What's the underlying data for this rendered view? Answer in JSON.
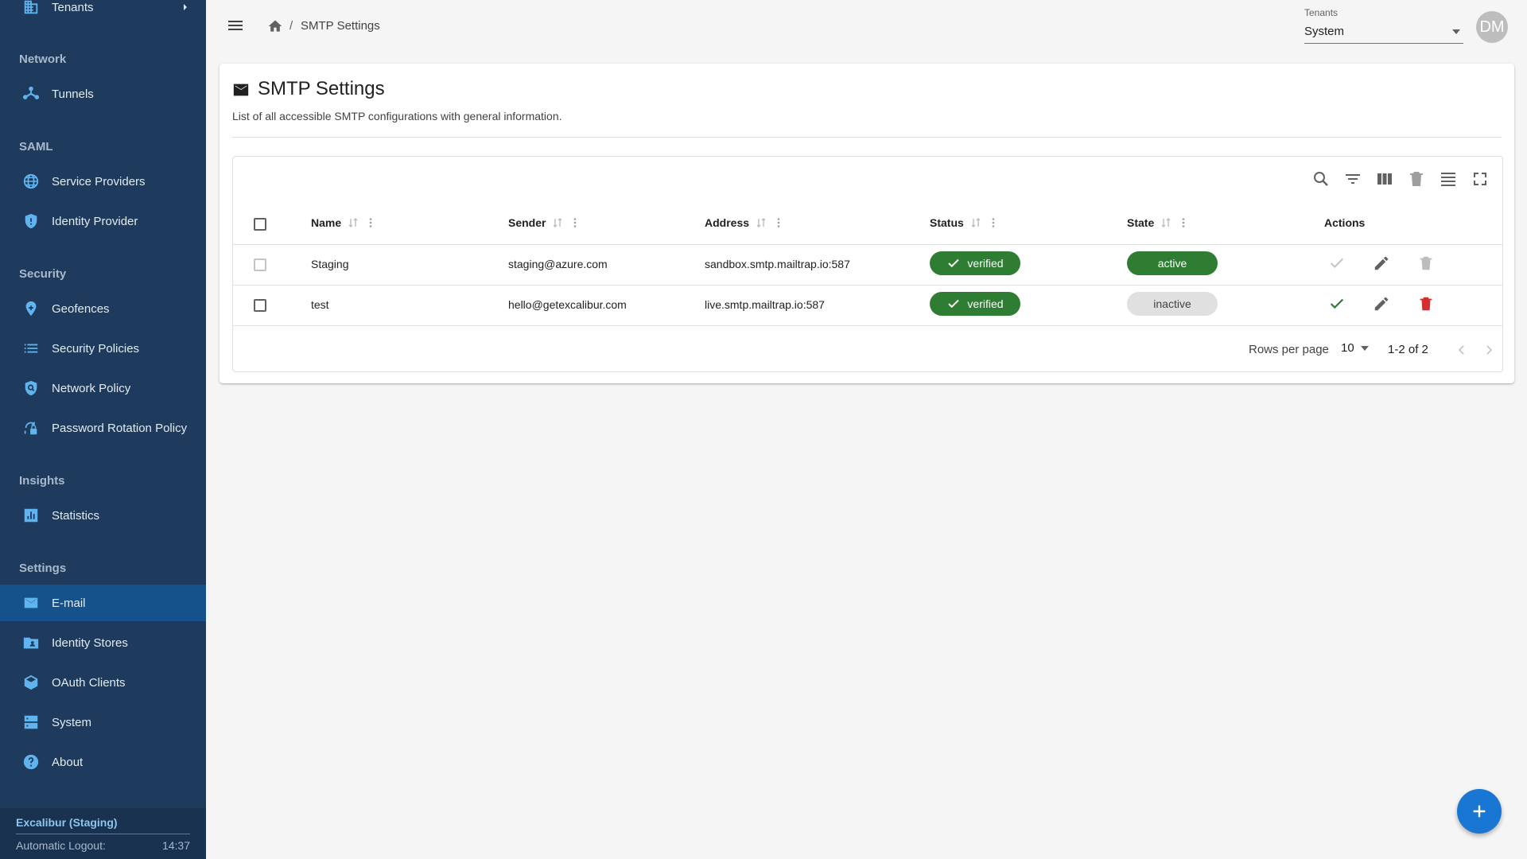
{
  "colors": {
    "sidebar_bg": "#1e3a5c",
    "sidebar_active": "#15528c",
    "sidebar_icon": "#5fb4f0",
    "accent": "#1976d2",
    "success": "#2e7d32",
    "danger": "#d32f2f"
  },
  "sidebar": {
    "top_item": {
      "label": "Tenants",
      "icon": "building-icon"
    },
    "sections": {
      "network": "Network",
      "saml": "SAML",
      "security": "Security",
      "insights": "Insights",
      "settings": "Settings"
    },
    "items": {
      "tunnels": {
        "label": "Tunnels",
        "icon": "tunnel-icon"
      },
      "service_providers": {
        "label": "Service Providers",
        "icon": "globe-icon"
      },
      "identity_provider": {
        "label": "Identity Provider",
        "icon": "shield-icon"
      },
      "geofences": {
        "label": "Geofences",
        "icon": "location-pin-icon"
      },
      "security_policies": {
        "label": "Security Policies",
        "icon": "list-icon"
      },
      "network_policy": {
        "label": "Network Policy",
        "icon": "shield-search-icon"
      },
      "password_rotation": {
        "label": "Password Rotation Policy",
        "icon": "lock-rotate-icon"
      },
      "statistics": {
        "label": "Statistics",
        "icon": "chart-icon"
      },
      "email": {
        "label": "E-mail",
        "icon": "envelope-icon",
        "active": true
      },
      "identity_stores": {
        "label": "Identity Stores",
        "icon": "folder-user-icon"
      },
      "oauth_clients": {
        "label": "OAuth Clients",
        "icon": "cube-icon"
      },
      "system": {
        "label": "System",
        "icon": "server-icon"
      },
      "about": {
        "label": "About",
        "icon": "help-icon"
      }
    },
    "footer": {
      "environment": "Excalibur (Staging)",
      "logout_label": "Automatic Logout:",
      "logout_time": "14:37"
    }
  },
  "topbar": {
    "breadcrumb_separator": "/",
    "breadcrumb_current": "SMTP Settings",
    "tenant_label": "Tenants",
    "tenant_value": "System",
    "avatar_initials": "DM"
  },
  "card": {
    "title": "SMTP Settings",
    "subtitle": "List of all accessible SMTP configurations with general information."
  },
  "table": {
    "columns": {
      "name": "Name",
      "sender": "Sender",
      "address": "Address",
      "status": "Status",
      "state": "State",
      "actions": "Actions"
    },
    "rows": [
      {
        "name": "Staging",
        "sender": "staging@azure.com",
        "address": "sandbox.smtp.mailtrap.io:587",
        "status": "verified",
        "state": "active"
      },
      {
        "name": "test",
        "sender": "hello@getexcalibur.com",
        "address": "live.smtp.mailtrap.io:587",
        "status": "verified",
        "state": "inactive"
      }
    ],
    "pagination": {
      "rows_per_page_label": "Rows per page",
      "rows_per_page": "10",
      "range": "1-2 of 2"
    }
  }
}
